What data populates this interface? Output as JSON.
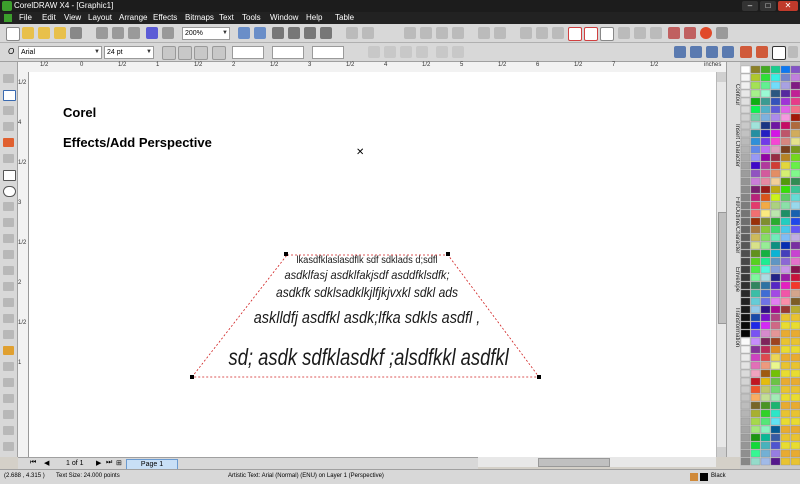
{
  "window": {
    "title": "CorelDRAW X4 - [Graphic1]",
    "min": "–",
    "max": "□",
    "close": "✕"
  },
  "menu": [
    "File",
    "Edit",
    "View",
    "Layout",
    "Arrange",
    "Effects",
    "Bitmaps",
    "Text",
    "Tools",
    "Window",
    "Help",
    "Table"
  ],
  "toolbar": {
    "zoom": "200%"
  },
  "properties": {
    "font_family": "Arial",
    "font_size": "24 pt",
    "font_glyph": "O"
  },
  "ruler": {
    "h_labels": [
      "1/2",
      "0",
      "1/2",
      "1",
      "1/2",
      "2",
      "1/2",
      "3",
      "1/2",
      "4",
      "1/2",
      "5",
      "1/2",
      "6",
      "1/2",
      "7",
      "1/2"
    ],
    "units": "inches",
    "v_labels": [
      "1/2",
      "4",
      "1/2",
      "3",
      "1/2",
      "2",
      "1/2",
      "1"
    ]
  },
  "canvas": {
    "heading1": "Corel",
    "heading2": "Effects/Add Perspective",
    "center_mark": "✕",
    "perspective_lines": [
      "lkasdfklaslasdflk sdf sdklads d;sdfl",
      "asdklfasj asdklfakjsdf asddfklsdfk;",
      "asdkfk sdklsadklkjlfjkjvxkl sdkl ads",
      "asklldfj asdfkl asdk;lfka sdkls asdfl ,",
      "sd; asdk sdfklasdkf ;alsdfkkl asdfkl"
    ]
  },
  "docker": {
    "tabs": [
      "Contour",
      "Insert Character",
      "Fill/Outline/Character",
      "Envelope",
      "Transformation"
    ]
  },
  "page_nav": {
    "page_count": "1 of 1",
    "page_tab": "Page 1"
  },
  "status": {
    "coords": "(2.688 , 4.315 )",
    "text_size": "Text Size: 24.000 points",
    "object_info": "Artistic Text: Arial (Normal) (ENU) on Layer 1  (Perspective)",
    "fill_label": "Black"
  },
  "colors": {
    "accent": "#1e90ff",
    "perspective_box": "#d02020"
  }
}
